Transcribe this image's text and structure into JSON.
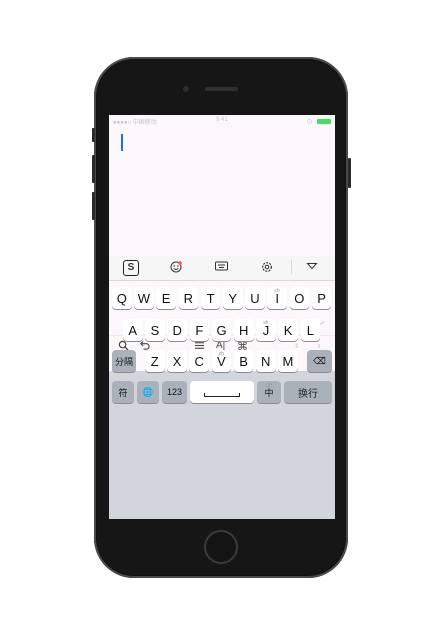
{
  "status_bar": {
    "carrier": "●●●●○ 中国移动",
    "time": "9:41",
    "battery_color": "#4cd964"
  },
  "editor": {
    "cursor_color": "#1a6ef0",
    "collapse_icon": "chevron-down-icon"
  },
  "toolbar": {
    "items": [
      "search-icon",
      "undo-icon",
      "list-icon",
      "format-icon",
      "command-icon",
      "arrow-left-icon",
      "arrow-right-icon"
    ],
    "format_label": "A|",
    "command_label": "⌘"
  },
  "keyboard_toolbar": {
    "items": [
      "sogou-logo-icon",
      "emoji-icon",
      "keyboard-icon",
      "settings-icon",
      "hide-keyboard-icon"
    ],
    "logo_label": "S"
  },
  "keyboard": {
    "row1": [
      "Q",
      "W",
      "E",
      "R",
      "T",
      "Y",
      "U",
      "I",
      "O",
      "P"
    ],
    "row1_sub": [
      "",
      "",
      "",
      "",
      "",
      "",
      "",
      "ch",
      "",
      ""
    ],
    "row2": [
      "A",
      "S",
      "D",
      "F",
      "G",
      "H",
      "J",
      "K",
      "L"
    ],
    "row2_sub": [
      "",
      "",
      "",
      "",
      "",
      "",
      "sh",
      "",
      ""
    ],
    "row3": [
      "Z",
      "X",
      "C",
      "V",
      "B",
      "N",
      "M"
    ],
    "row3_sub": [
      "",
      "",
      "",
      "zh",
      "",
      "",
      ""
    ],
    "separator_key": "分隔",
    "delete_key": "⌫",
    "symbol_key": "符",
    "globe_key": "🌐",
    "number_key": "123",
    "lang_key": "中",
    "lang_key_sub": "/英",
    "enter_key": "换行"
  }
}
